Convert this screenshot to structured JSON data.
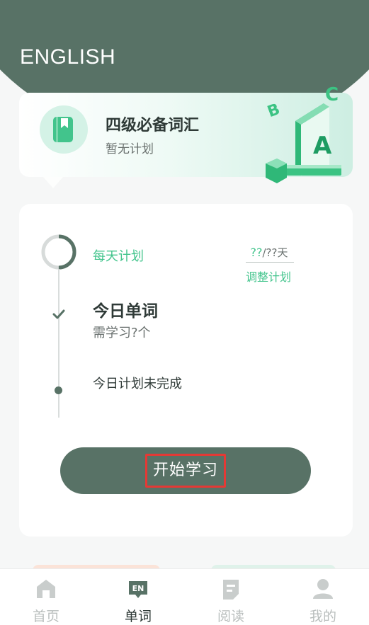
{
  "header": {
    "title": "ENGLISH"
  },
  "book": {
    "title": "四级必备词汇",
    "subtitle": "暂无计划",
    "deco_letters": [
      "B",
      "C",
      "A"
    ]
  },
  "plan": {
    "daily_label": "每天计划",
    "ratio_num": "??",
    "ratio_rest": "/??天",
    "adjust_label": "调整计划",
    "today_words_label": "今日单词",
    "need_learn": "需学习?个",
    "status": "今日计划未完成",
    "progress_fraction": 0.5,
    "start_label": "开始学习"
  },
  "tabs": [
    {
      "label": "首页",
      "icon": "home-icon",
      "active": false
    },
    {
      "label": "单词",
      "icon": "en-icon",
      "badge": "EN",
      "active": true
    },
    {
      "label": "阅读",
      "icon": "reading-icon",
      "active": false
    },
    {
      "label": "我的",
      "icon": "profile-icon",
      "active": false
    }
  ],
  "colors": {
    "primary": "#587266",
    "accent": "#42c48c",
    "highlight": "#e53935"
  }
}
